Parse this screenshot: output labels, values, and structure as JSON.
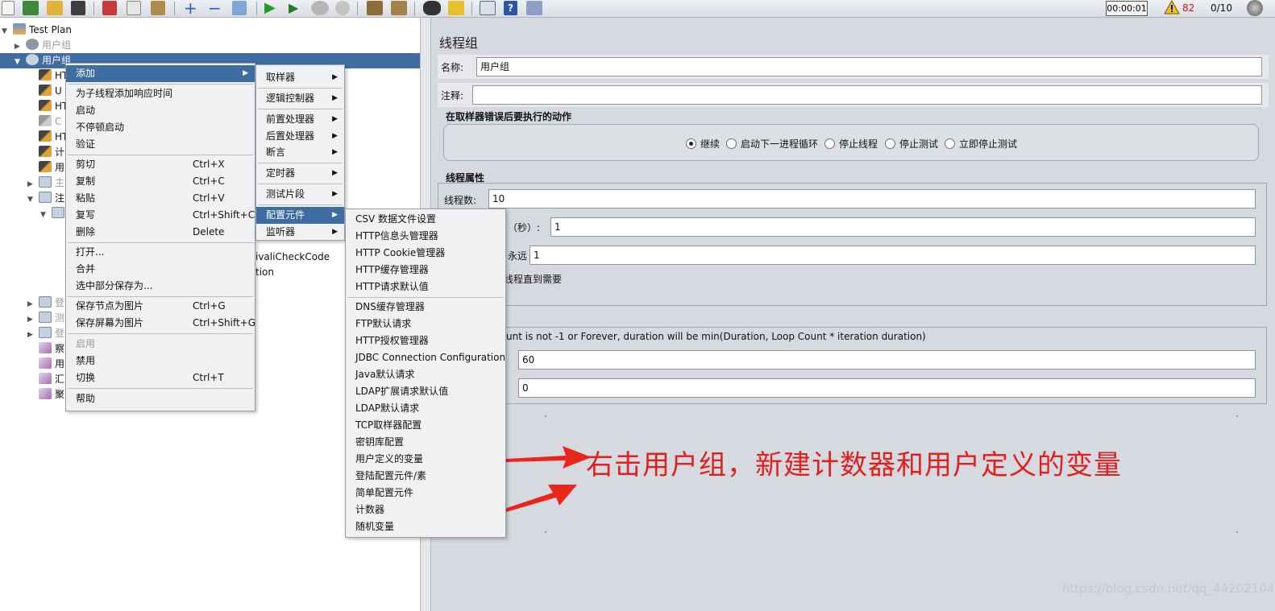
{
  "toolbar": {
    "timer": "00:00:01",
    "warning_count": "82",
    "thread_count": "0/10"
  },
  "tree": {
    "root": "Test Plan",
    "items": [
      {
        "label": "用户组",
        "disabled": true
      },
      {
        "label": "用户组",
        "selected": true
      },
      {
        "label": "HT"
      },
      {
        "label": "U"
      },
      {
        "label": "HT"
      },
      {
        "label": "C",
        "disabled": true
      },
      {
        "label": "HT"
      },
      {
        "label": "计"
      },
      {
        "label": "用"
      },
      {
        "label": "主",
        "disabled": true
      },
      {
        "label": "注"
      },
      {
        "label": "登",
        "disabled": true
      },
      {
        "label": "测",
        "disabled": true
      },
      {
        "label": "登",
        "disabled": true
      },
      {
        "label": "察"
      },
      {
        "label": "用"
      },
      {
        "label": "汇"
      },
      {
        "label": "聚"
      }
    ],
    "partial_labels": [
      "ivaliCheckCode",
      "tion"
    ]
  },
  "context_menu": {
    "items": [
      {
        "label": "添加",
        "highlighted": true,
        "submenu": true
      },
      {
        "label": "为子线程添加响应时间"
      },
      {
        "label": "启动"
      },
      {
        "label": "不停顿启动"
      },
      {
        "label": "验证"
      },
      {
        "label": "剪切",
        "shortcut": "Ctrl+X"
      },
      {
        "label": "复制",
        "shortcut": "Ctrl+C"
      },
      {
        "label": "粘贴",
        "shortcut": "Ctrl+V"
      },
      {
        "label": "复写",
        "shortcut": "Ctrl+Shift+C"
      },
      {
        "label": "删除",
        "shortcut": "Delete"
      },
      {
        "label": "打开..."
      },
      {
        "label": "合并"
      },
      {
        "label": "选中部分保存为..."
      },
      {
        "label": "保存节点为图片",
        "shortcut": "Ctrl+G"
      },
      {
        "label": "保存屏幕为图片",
        "shortcut": "Ctrl+Shift+G"
      },
      {
        "label": "启用",
        "disabled": true
      },
      {
        "label": "禁用"
      },
      {
        "label": "切换",
        "shortcut": "Ctrl+T"
      },
      {
        "label": "帮助"
      }
    ]
  },
  "add_submenu": {
    "items": [
      {
        "label": "取样器"
      },
      {
        "label": "逻辑控制器"
      },
      {
        "label": "前置处理器"
      },
      {
        "label": "后置处理器"
      },
      {
        "label": "断言"
      },
      {
        "label": "定时器"
      },
      {
        "label": "测试片段"
      },
      {
        "label": "配置元件",
        "highlighted": true
      },
      {
        "label": "监听器"
      }
    ]
  },
  "config_submenu": {
    "items": [
      "CSV 数据文件设置",
      "HTTP信息头管理器",
      "HTTP Cookie管理器",
      "HTTP缓存管理器",
      "HTTP请求默认值",
      "DNS缓存管理器",
      "FTP默认请求",
      "HTTP授权管理器",
      "JDBC Connection Configuration",
      "Java默认请求",
      "LDAP扩展请求默认值",
      "LDAP默认请求",
      "TCP取样器配置",
      "密钥库配置",
      "用户定义的变量",
      "登陆配置元件/素",
      "简单配置元件",
      "计数器",
      "随机变量"
    ]
  },
  "thread_group": {
    "title": "线程组",
    "name_label": "名称:",
    "name_value": "用户组",
    "comment_label": "注释:",
    "comment_value": "",
    "error_action_title": "在取样器错误后要执行的动作",
    "error_actions": [
      {
        "label": "继续",
        "checked": true
      },
      {
        "label": "启动下一进程循环",
        "checked": false
      },
      {
        "label": "停止线程",
        "checked": false
      },
      {
        "label": "停止测试",
        "checked": false
      },
      {
        "label": "立即停止测试",
        "checked": false
      }
    ],
    "thread_props_title": "线程属性",
    "threads_label": "线程数:",
    "threads_value": "10",
    "rampup_label_partial": "（秒）:",
    "rampup_value": "1",
    "loop_label_partial": "永远",
    "loop_value": "1",
    "delay_label_partial": "线程直到需要",
    "scheduler_note_partial": "unt is not -1 or Forever, duration will be min(Duration, Loop Count * iteration duration)",
    "duration_value": "60",
    "startup_delay_value": "0"
  },
  "annotation": {
    "text": "右击用户组，新建计数器和用户定义的变量",
    "color": "#e0201c"
  },
  "watermark": "https://blog.csdn.net/qq_44202104"
}
